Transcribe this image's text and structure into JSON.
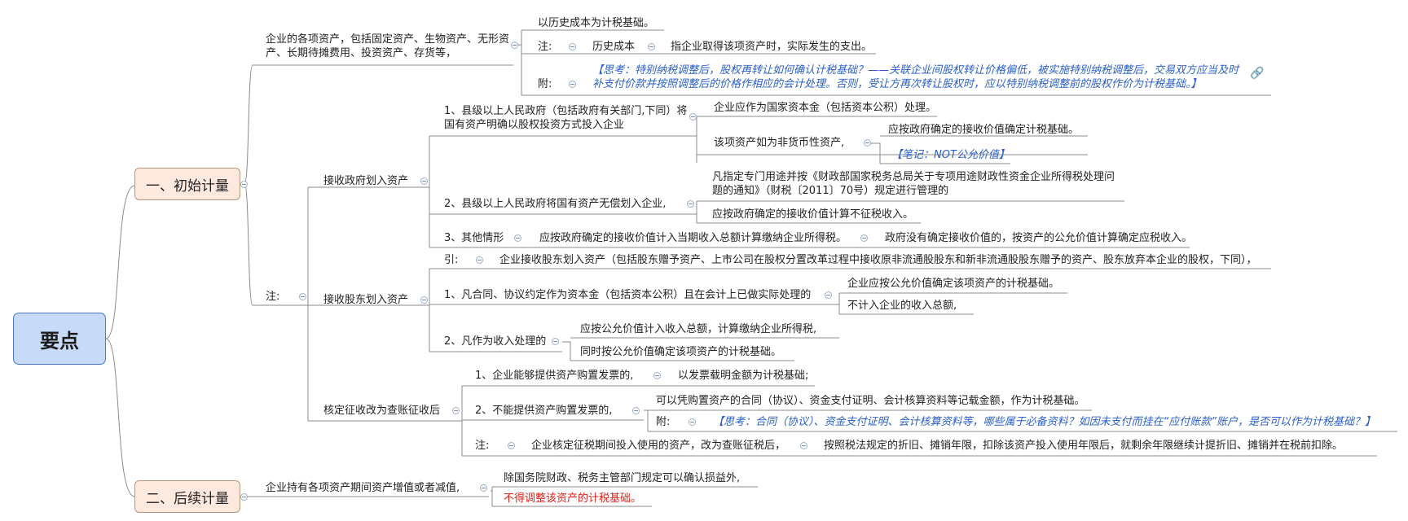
{
  "root": "要点",
  "b1": {
    "label": "一、初始计量",
    "assets": "企业的各项资产，包括固定资产、生物资产、无形资产、长期待摊费用、投资资产、存货等，",
    "basis": "以历史成本为计税基础。",
    "note_label": "注:",
    "hist_cost": "历史成本",
    "hist_cost_def": "指企业取得该项资产时，实际发生的支出。",
    "attach_label": "附:",
    "attach_text": "【思考：特别纳税调整后，股权再转让如何确认计税基础？——关联企业间股权转让价格偏低，被实施特别纳税调整后，交易双方应当及时补支付价款并按照调整后的价格作相应的会计处理。否则，受让方再次转让股权时，应以特别纳税调整前的股权作价为计税基础。】",
    "zhu": "注:",
    "gov": {
      "label": "接收政府划入资产",
      "c1": "1、县级以上人民政府（包括政府有关部门,下同）将国有资产明确以股权投资方式投入企业",
      "c1a": "企业应作为国家资本金（包括资本公积）处理。",
      "c1b": "该项资产如为非货币性资产,",
      "c1b1": "应按政府确定的接收价值确定计税基础。",
      "c1b2": "【笔记：NOT公允价值】",
      "c2": "2、县级以上人民政府将国有资产无偿划入企业,",
      "c2a": "凡指定专门用途并按《财政部国家税务总局关于专项用途财政性资金企业所得税处理问题的通知》（财税〔2011〕70号）规定进行管理的",
      "c2b": "应按政府确定的接收价值计算不征税收入。",
      "c3": "3、其他情形",
      "c3a": "应按政府确定的接收价值计入当期收入总额计算缴纳企业所得税。",
      "c3b": "政府没有确定接收价值的，按资产的公允价值计算确定应税收入。"
    },
    "sh": {
      "label": "接收股东划入资产",
      "yin": "引:",
      "yin_text": "企业接收股东划入资产（包括股东赠予资产、上市公司在股权分置改革过程中接收原非流通股股东和新非流通股股东赠予的资产、股东放弃本企业的股权，下同），",
      "c1": "1、凡合同、协议约定作为资本金（包括资本公积）且在会计上已做实际处理的",
      "c1a": "企业应按公允价值确定该项资产的计税基础。",
      "c1b": "不计入企业的收入总额,",
      "c2": "2、凡作为收入处理的",
      "c2a": "应按公允价值计入收入总额，计算缴纳企业所得税,",
      "c2b": "同时按公允价值确定该项资产的计税基础。"
    },
    "hd": {
      "label": "核定征收改为查账征收后",
      "c1": "1、企业能够提供资产购置发票的,",
      "c1a": "以发票载明金额为计税基础;",
      "c2": "2、不能提供资产购置发票的,",
      "c2a": "可以凭购置资产的合同（协议）、资金支付证明、会计核算资料等记载金额，作为计税基础。",
      "c2b_label": "附:",
      "c2b_text": "【思考：合同（协议）、资金支付证明、会计核算资料等，哪些属于必备资料？如因未支付而挂在“应付账款”账户，是否可以作为计税基础？】",
      "zhu": "注:",
      "zhu_a": "企业核定征税期间投入使用的资产，改为查账征税后，",
      "zhu_b": "按照税法规定的折旧、摊销年限，扣除该资产投入使用年限后，就剩余年限继续计提折旧、摊销并在税前扣除。"
    }
  },
  "b2": {
    "label": "二、后续计量",
    "c": "企业持有各项资产期间资产增值或者减值,",
    "c1": "除国务院财政、税务主管部门规定可以确认损益外,",
    "c2": "不得调整该资产的计税基础。"
  },
  "colors": {
    "line": "#8b8b8b",
    "blue": "#2a5fc9",
    "red": "#e0201a",
    "root_fill": "#c7daf7",
    "main_fill": "#fde9dd"
  },
  "icons": {
    "link": "link-icon",
    "toggle": "collapse-icon"
  }
}
